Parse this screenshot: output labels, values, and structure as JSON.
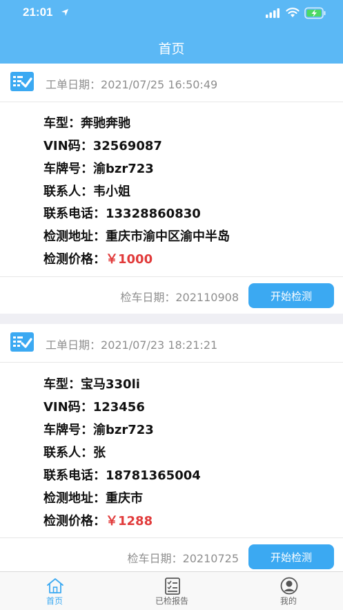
{
  "status_bar": {
    "time": "21:01"
  },
  "header": {
    "title": "首页"
  },
  "orders": [
    {
      "order_date_label": "工单日期：",
      "order_date": "2021/07/25 16:50:49",
      "car_model_label": "车型：",
      "car_model": "奔驰奔驰",
      "vin_label": "VIN码：",
      "vin": "32569087",
      "plate_label": "车牌号：",
      "plate": "渝bzr723",
      "contact_label": "联系人：",
      "contact": "韦小姐",
      "phone_label": "联系电话：",
      "phone": "13328860830",
      "address_label": "检测地址：",
      "address": "重庆市渝中区渝中半岛",
      "price_label": "检测价格：",
      "price": "￥1000",
      "check_date_label": "检车日期：",
      "check_date": "202110908",
      "button_label": "开始检测"
    },
    {
      "order_date_label": "工单日期：",
      "order_date": "2021/07/23 18:21:21",
      "car_model_label": "车型：",
      "car_model": "宝马330li",
      "vin_label": "VIN码：",
      "vin": "123456",
      "plate_label": "车牌号：",
      "plate": "渝bzr723",
      "contact_label": "联系人：",
      "contact": "张",
      "phone_label": "联系电话：",
      "phone": "18781365004",
      "address_label": "检测地址：",
      "address": "重庆市",
      "price_label": "检测价格：",
      "price": "￥1288",
      "check_date_label": "检车日期：",
      "check_date": "20210725",
      "button_label": "开始检测"
    }
  ],
  "tabbar": {
    "items": [
      {
        "label": "首页",
        "icon": "home-icon",
        "active": true
      },
      {
        "label": "已检报告",
        "icon": "report-icon",
        "active": false
      },
      {
        "label": "我的",
        "icon": "user-icon",
        "active": false
      }
    ]
  },
  "colors": {
    "header_bg": "#5bb8f5",
    "button_bg": "#3ba9f2",
    "price": "#e13b3b",
    "active_tab": "#3ba9f2"
  }
}
